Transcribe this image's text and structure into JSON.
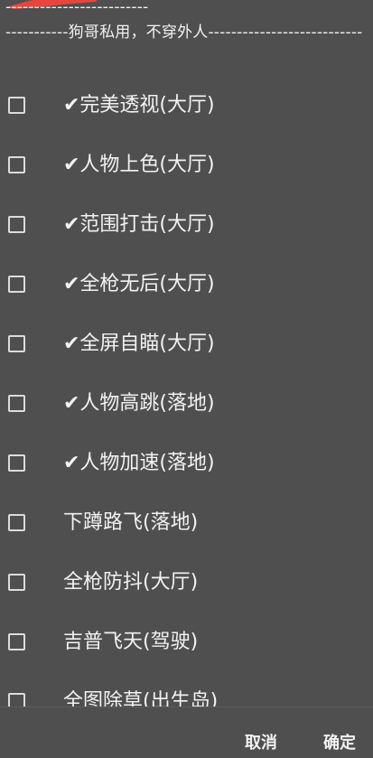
{
  "header": {
    "text": "-------------------------\n-----------狗哥私用，不穿外人---------------------------"
  },
  "items": [
    {
      "label": "✔完美透视(大厅)",
      "checked": false
    },
    {
      "label": "✔人物上色(大厅)",
      "checked": false
    },
    {
      "label": "✔范围打击(大厅)",
      "checked": false
    },
    {
      "label": "✔全枪无后(大厅)",
      "checked": false
    },
    {
      "label": "✔全屏自瞄(大厅)",
      "checked": false
    },
    {
      "label": "✔人物高跳(落地)",
      "checked": false
    },
    {
      "label": "✔人物加速(落地)",
      "checked": false
    },
    {
      "label": "下蹲路飞(落地)",
      "checked": false
    },
    {
      "label": "全枪防抖(大厅)",
      "checked": false
    },
    {
      "label": "吉普飞天(驾驶)",
      "checked": false
    },
    {
      "label": "全图除草(出生岛)",
      "checked": false
    }
  ],
  "footer": {
    "cancel_label": "取消",
    "ok_label": "确定"
  },
  "colors": {
    "background": "#4f4f4f",
    "text": "#f2f2f2",
    "checkbox_border": "#dcdcdc",
    "accent_stroke": "#e8453c"
  }
}
